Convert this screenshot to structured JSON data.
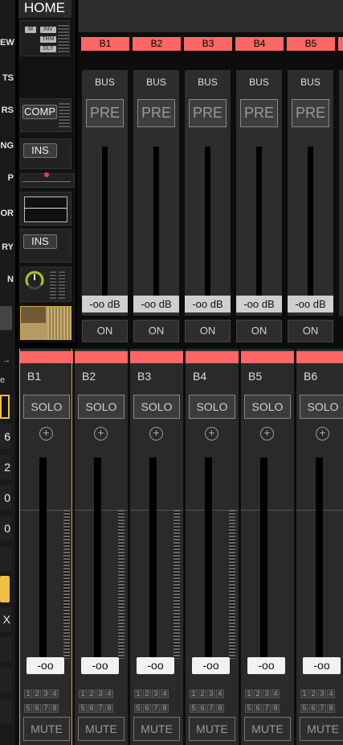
{
  "sidebar": {
    "items": [
      {
        "label": "EW"
      },
      {
        "label": "TS"
      },
      {
        "label": "RS"
      },
      {
        "label": "NG"
      },
      {
        "label": "P"
      },
      {
        "label": "OR"
      },
      {
        "label": "RY"
      },
      {
        "label": "N"
      }
    ],
    "numbers": [
      "6",
      "2",
      "0",
      "0"
    ],
    "letter": "X"
  },
  "strip": {
    "home_label": "HOME",
    "tags": {
      "m": "M",
      "inv": "INV",
      "trm": "TRM",
      "dly": "DLY"
    },
    "comp_label": "COMP",
    "ins1_label": "INS",
    "ins2_label": "INS"
  },
  "bus_top": {
    "tags": [
      "B1",
      "B2",
      "B3",
      "B4",
      "B5"
    ],
    "panels": [
      {
        "bus": "BUS",
        "pre": "PRE",
        "db": "-oo dB",
        "on": "ON"
      },
      {
        "bus": "BUS",
        "pre": "PRE",
        "db": "-oo dB",
        "on": "ON"
      },
      {
        "bus": "BUS",
        "pre": "PRE",
        "db": "-oo dB",
        "on": "ON"
      },
      {
        "bus": "BUS",
        "pre": "PRE",
        "db": "-oo dB",
        "on": "ON"
      },
      {
        "bus": "BUS",
        "pre": "PRE",
        "db": "-oo dB",
        "on": "ON"
      }
    ]
  },
  "mixer": {
    "channels": [
      {
        "name": "B1",
        "solo": "SOLO",
        "value": "-oo",
        "mute": "MUTE",
        "selected": true
      },
      {
        "name": "B2",
        "solo": "SOLO",
        "value": "-oo",
        "mute": "MUTE",
        "selected": false
      },
      {
        "name": "B3",
        "solo": "SOLO",
        "value": "-oo",
        "mute": "MUTE",
        "selected": false
      },
      {
        "name": "B4",
        "solo": "SOLO",
        "value": "-oo",
        "mute": "MUTE",
        "selected": false
      },
      {
        "name": "B5",
        "solo": "SOLO",
        "value": "-oo",
        "mute": "MUTE",
        "selected": false
      },
      {
        "name": "B6",
        "solo": "SOLO",
        "value": "-oo",
        "mute": "MUTE",
        "selected": false
      }
    ],
    "assign_numbers": [
      "1",
      "2",
      "3",
      "4",
      "5",
      "6",
      "7",
      "8"
    ]
  },
  "colors": {
    "bus_accent": "#ff6666",
    "selection": "#d7a84a",
    "sidebar_highlight": "#f0c040"
  }
}
